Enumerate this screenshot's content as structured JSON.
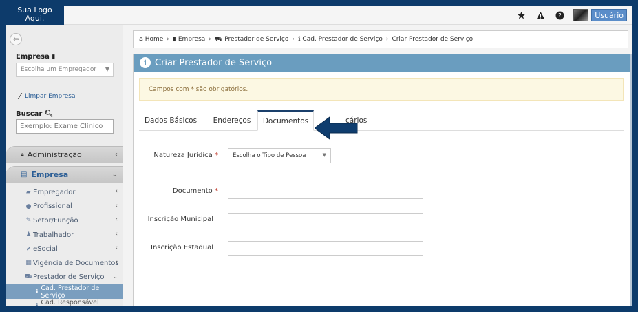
{
  "logo": {
    "line1": "Sua Logo",
    "line2": "Aqui."
  },
  "topbar": {
    "icons": [
      "star-icon",
      "warning-icon",
      "help-icon"
    ],
    "user_label": "Usuário"
  },
  "sidebar": {
    "empresa_label": "Empresa",
    "empresa_select": "Escolha um Empregador",
    "limpar": "Limpar Empresa",
    "buscar_label": "Buscar",
    "buscar_placeholder": "Exemplo: Exame Clínico",
    "sections": [
      {
        "label": "Administração"
      },
      {
        "label": "Empresa"
      }
    ],
    "items": [
      {
        "label": "Empregador"
      },
      {
        "label": "Profissional"
      },
      {
        "label": "Setor/Função"
      },
      {
        "label": "Trabalhador"
      },
      {
        "label": "eSocial"
      },
      {
        "label": "Vigência de Documentos"
      },
      {
        "label": "Prestador de Serviço"
      }
    ],
    "subitems": [
      {
        "label": "Cad. Prestador de Serviço"
      },
      {
        "label": "Cad. Responsável Técnico"
      }
    ]
  },
  "breadcrumb": [
    {
      "label": "Home"
    },
    {
      "label": "Empresa"
    },
    {
      "label": "Prestador de Serviço"
    },
    {
      "label": "Cad. Prestador de Serviço"
    },
    {
      "label": "Criar Prestador de Serviço"
    }
  ],
  "panel": {
    "title": "Criar Prestador de Serviço",
    "alert": "Campos com * são obrigatórios."
  },
  "tabs": [
    {
      "label": "Dados Básicos"
    },
    {
      "label": "Endereços"
    },
    {
      "label": "Documentos"
    },
    {
      "label": "cários"
    }
  ],
  "form": {
    "natureza_label": "Natureza Jurídica",
    "natureza_value": "Escolha o Tipo de Pessoa",
    "documento_label": "Documento",
    "inscricao_municipal_label": "Inscrição Municipal",
    "inscricao_estadual_label": "Inscrição Estadual",
    "required_mark": "*"
  },
  "colors": {
    "frame": "#0d3b6b",
    "panel_header": "#6a9dbf",
    "active_tab_border": "#1a3f6b",
    "arrow": "#0f3d6e"
  }
}
